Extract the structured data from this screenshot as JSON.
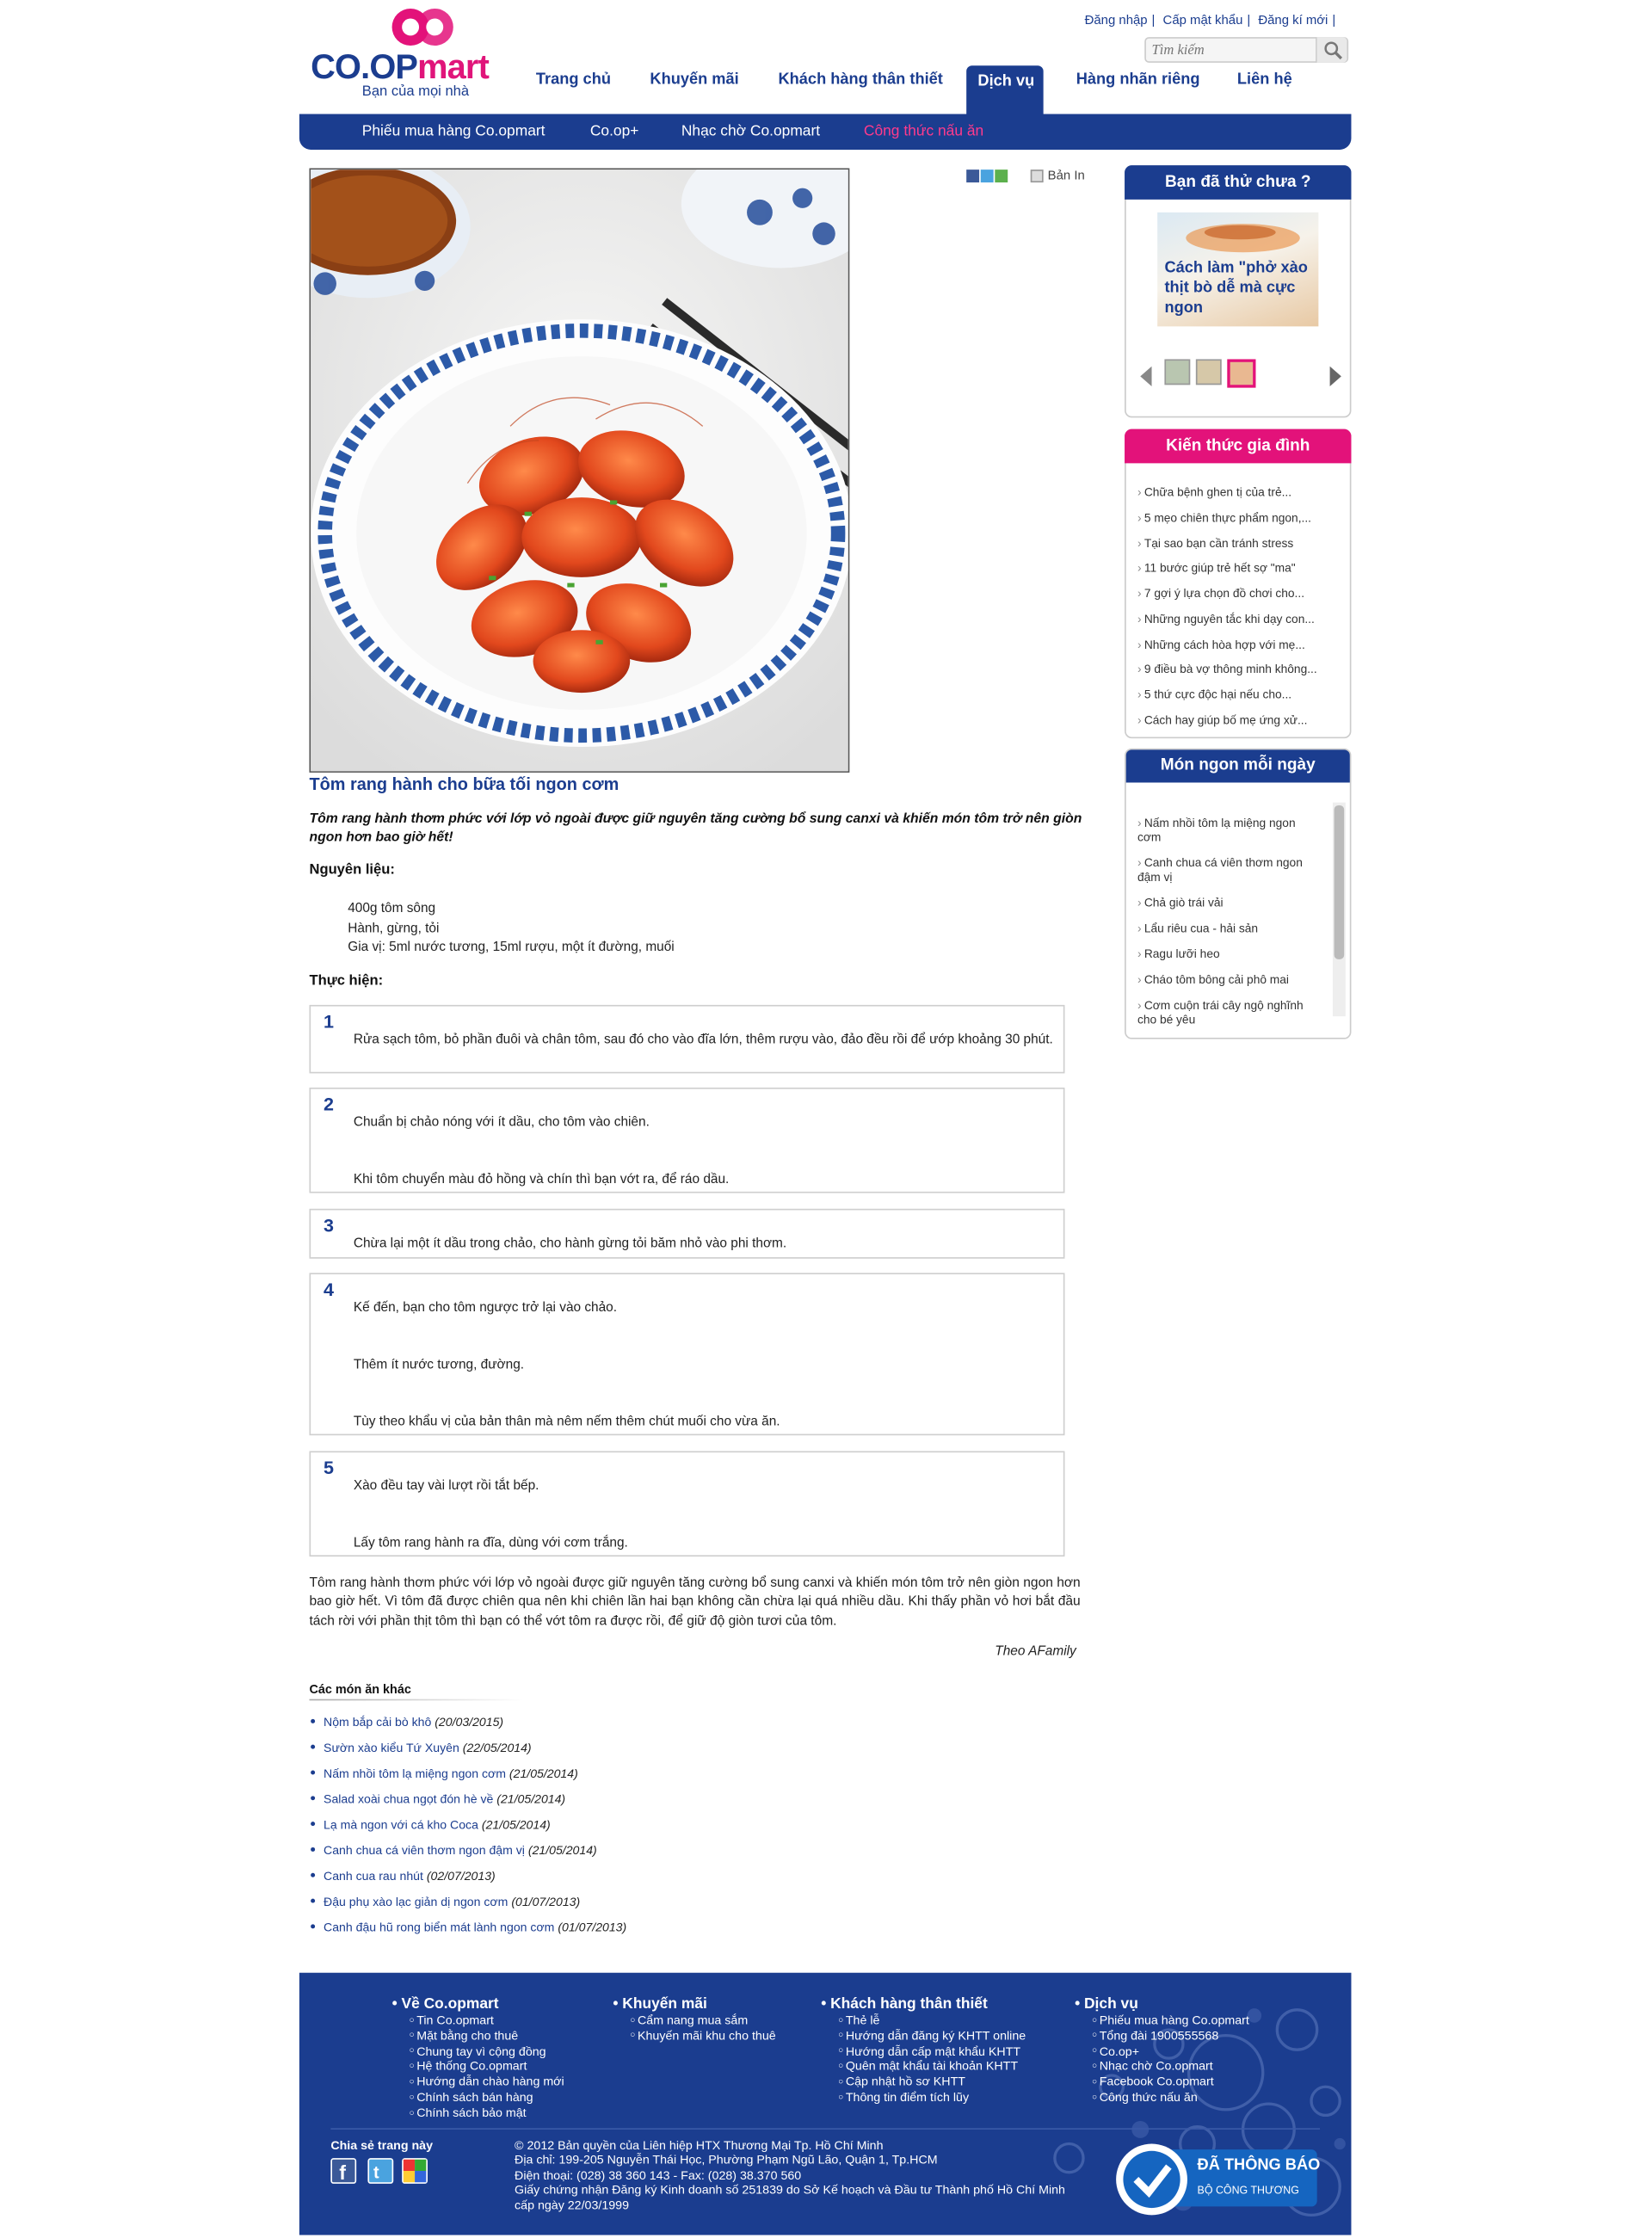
{
  "header": {
    "logo_text": "CO.OP",
    "logo_mart": "mart",
    "logo_tagline": "Bạn của mọi nhà",
    "top_links": [
      "Đăng nhập",
      "Cấp mật khẩu",
      "Đăng kí mới"
    ],
    "search_placeholder": "Tìm kiếm",
    "nav": [
      "Trang chủ",
      "Khuyến mãi",
      "Khách hàng thân thiết",
      "Dịch vụ",
      "Hàng nhãn riêng",
      "Liên hệ"
    ],
    "nav_active": "Dịch vụ",
    "subnav": [
      "Phiếu mua hàng Co.opmart",
      "Co.op+",
      "Nhạc chờ Co.opmart",
      "Công thức nấu ăn"
    ],
    "subnav_active": "Công thức nấu ăn"
  },
  "share_tools": {
    "print_label": "Bản In",
    "icons": [
      "facebook-icon",
      "twitter-icon",
      "google-icon"
    ]
  },
  "article": {
    "title": "Tôm rang hành cho bữa tối ngon cơm",
    "lead": "Tôm rang hành thơm phức với lớp vỏ ngoài được giữ nguyên tăng cường bổ sung canxi và khiến món tôm trở nên giòn ngon hơn bao giờ hết!",
    "ingredients_heading": "Nguyên liệu:",
    "ingredients": [
      "400g tôm sông",
      "Hành, gừng, tỏi",
      "Gia vị: 5ml nước tương, 15ml rượu, một ít đường, muối"
    ],
    "steps_heading": "Thực hiện:",
    "steps": [
      {
        "num": "1",
        "lines": [
          "Rửa sạch tôm, bỏ phần đuôi và chân tôm, sau đó cho vào đĩa lớn, thêm rượu vào, đảo đều rồi để ướp khoảng 30 phút."
        ]
      },
      {
        "num": "2",
        "lines": [
          "Chuẩn bị chảo nóng với ít dầu, cho tôm vào chiên.",
          "Khi tôm chuyển màu đỏ hồng và chín thì bạn vớt ra, để ráo dầu."
        ]
      },
      {
        "num": "3",
        "lines": [
          "Chừa lại một ít dầu trong chảo, cho hành gừng tỏi băm nhỏ vào phi thơm."
        ]
      },
      {
        "num": "4",
        "lines": [
          "Kế đến, bạn cho tôm ngược trở lại vào chảo.",
          "Thêm ít nước tương, đường.",
          "Tùy theo khẩu vị của bản thân mà nêm nếm thêm chút muối cho vừa ăn."
        ]
      },
      {
        "num": "5",
        "lines": [
          "Xào đều tay vài lượt rồi tắt bếp.",
          "Lấy tôm rang hành ra đĩa, dùng với cơm trắng."
        ]
      }
    ],
    "summary": "Tôm rang hành thơm phức với lớp vỏ ngoài được giữ nguyên tăng cường bổ sung canxi và khiến món tôm trở nên giòn ngon hơn bao giờ hết. Vì tôm đã được chiên qua nên khi chiên lần hai bạn không cần chừa lại quá nhiều dầu. Khi thấy phần vỏ hơi bắt đầu tách rời với phần thịt tôm thì bạn có thể vớt tôm ra được rồi, để giữ độ giòn tươi của tôm.",
    "source": "Theo AFamily"
  },
  "other_dishes": {
    "heading": "Các món ăn khác",
    "items": [
      {
        "name": "Nộm bắp cải bò khô",
        "date": "(20/03/2015)"
      },
      {
        "name": "Sườn xào kiểu Tứ Xuyên",
        "date": "(22/05/2014)"
      },
      {
        "name": "Nấm nhồi tôm lạ miệng ngon cơm",
        "date": "(21/05/2014)"
      },
      {
        "name": "Salad xoài chua ngọt đón hè về",
        "date": "(21/05/2014)"
      },
      {
        "name": "Lạ mà ngon với cá kho Coca",
        "date": "(21/05/2014)"
      },
      {
        "name": "Canh chua cá viên thơm ngon đậm vị",
        "date": "(21/05/2014)"
      },
      {
        "name": "Canh cua rau nhút",
        "date": "(02/07/2013)"
      },
      {
        "name": "Đậu phụ xào lạc giản dị ngon cơm",
        "date": "(01/07/2013)"
      },
      {
        "name": "Canh đậu hũ rong biển mát lành ngon cơm",
        "date": "(01/07/2013)"
      }
    ]
  },
  "sidebar": {
    "try_box": {
      "heading": "Bạn đã thử chưa ?",
      "caption": "Cách làm \"phở xào thịt bò dễ mà cực ngon"
    },
    "knowledge": {
      "heading": "Kiến thức gia đình",
      "items": [
        "Chữa bệnh ghen tị của trẻ...",
        "5 mẹo chiên thực phẩm ngon,...",
        "Tại sao bạn cần tránh stress",
        "11 bước giúp trẻ hết sợ \"ma\"",
        "7 gợi ý lựa chọn đồ chơi cho...",
        "Những nguyên tắc khi dạy con...",
        "Những cách hòa hợp với mẹ...",
        "9 điều bà vợ thông minh không...",
        "5 thứ cực độc hại nếu cho...",
        "Cách hay giúp bố mẹ ứng xử..."
      ]
    },
    "daily": {
      "heading": "Món ngon mỗi ngày",
      "items": [
        [
          "Nấm nhồi tôm lạ miệng ngon",
          "cơm"
        ],
        [
          "Canh chua cá viên thơm ngon",
          "đậm vị"
        ],
        [
          "Chả giò trái vải"
        ],
        [
          "Lẩu riêu cua - hải sản"
        ],
        [
          "Ragu lưỡi heo"
        ],
        [
          "Cháo tôm bông cải phô mai"
        ],
        [
          "Cơm cuộn trái cây ngộ nghĩnh",
          "cho bé yêu"
        ]
      ]
    }
  },
  "footer": {
    "columns": [
      {
        "heading": "Về Co.opmart",
        "items": [
          "Tin Co.opmart",
          "Mặt bằng cho thuê",
          "Chung tay vì cộng đồng",
          "Hệ thống Co.opmart",
          "Hướng dẫn chào hàng mới",
          "Chính sách bán hàng",
          "Chính sách bảo mật"
        ]
      },
      {
        "heading": "Khuyến mãi",
        "items": [
          "Cẩm nang mua sắm",
          "Khuyến mãi khu cho thuê"
        ]
      },
      {
        "heading": "Khách hàng thân thiết",
        "items": [
          "Thẻ lễ",
          "Hướng dẫn đăng ký KHTT online",
          "Hướng dẫn cấp mật khẩu KHTT",
          "Quên mật khẩu tài khoản KHTT",
          "Cập nhật hồ sơ KHTT",
          "Thông tin điểm tích lũy"
        ]
      },
      {
        "heading": "Dịch vụ",
        "items": [
          "Phiếu mua hàng Co.opmart",
          "Tổng đài 1900555568",
          "Co.op+",
          "Nhạc chờ Co.opmart",
          "Facebook Co.opmart",
          "Công thức nấu ăn"
        ]
      }
    ],
    "share_label": "Chia sẻ trang này",
    "copyright": [
      "© 2012 Bản quyền của Liên hiệp HTX Thương Mại Tp. Hồ Chí Minh",
      "Địa chỉ: 199-205 Nguyễn Thái Học, Phường Phạm Ngũ Lão, Quận 1, Tp.HCM",
      "Điện thoại: (028) 38 360 143 - Fax: (028) 38.370 560",
      "Giấy chứng nhận Đăng ký Kinh doanh số 251839 do Sở Kế hoạch và Đầu tư Thành phố Hồ Chí Minh",
      "cấp ngày 22/03/1999"
    ],
    "badge_title": "ĐÃ THÔNG BÁO",
    "badge_sub": "BỘ CÔNG THƯƠNG"
  },
  "colors": {
    "brand_blue": "#1b3d8f",
    "brand_pink": "#e3127a",
    "link": "#1b3d8f"
  }
}
